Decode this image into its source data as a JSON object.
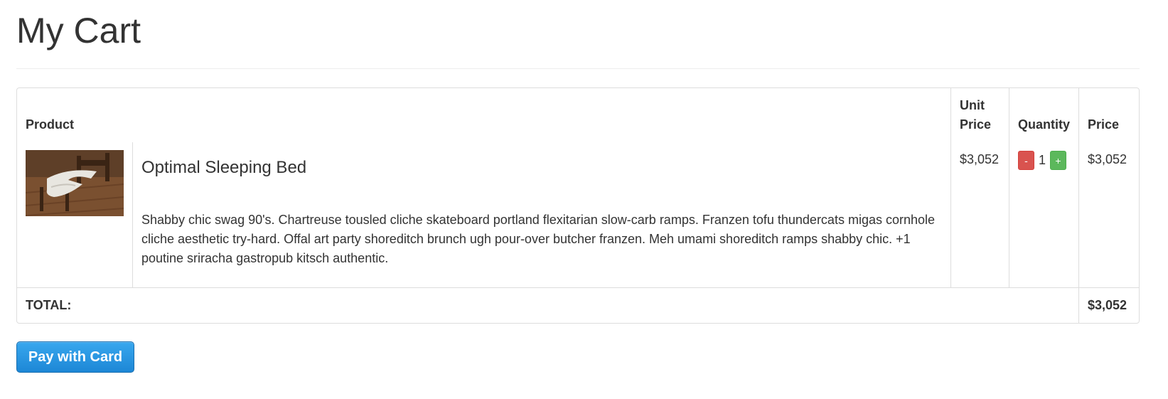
{
  "page": {
    "title": "My Cart"
  },
  "table": {
    "headers": {
      "product": "Product",
      "unit_price": "Unit Price",
      "quantity": "Quantity",
      "price": "Price"
    },
    "items": [
      {
        "image_icon": "bed-product-photo",
        "name": "Optimal Sleeping Bed",
        "description": "Shabby chic swag 90's. Chartreuse tousled cliche skateboard portland flexitarian slow-carb ramps. Franzen tofu thundercats migas cornhole cliche aesthetic try-hard. Offal art party shoreditch brunch ugh pour-over butcher franzen. Meh umami shoreditch ramps shabby chic. +1 poutine sriracha gastropub kitsch authentic.",
        "unit_price": "$3,052",
        "quantity": "1",
        "decrement_label": "-",
        "increment_label": "+",
        "price": "$3,052"
      }
    ],
    "total_label": "TOTAL:",
    "total_value": "$3,052"
  },
  "actions": {
    "pay_label": "Pay with Card"
  },
  "colors": {
    "decrement": "#d9534f",
    "increment": "#5cb85c",
    "pay_button": "#1d87d6"
  }
}
